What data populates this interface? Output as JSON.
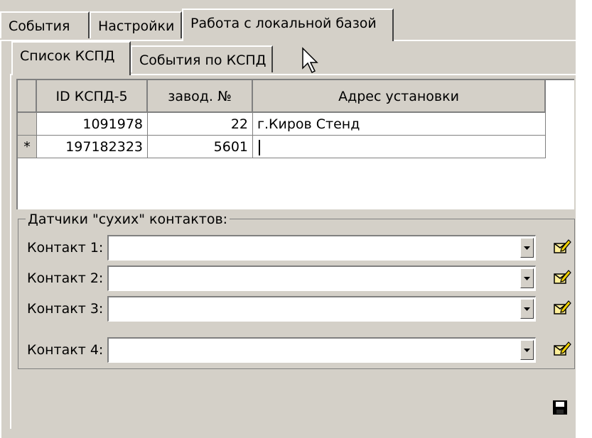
{
  "top_tabs": [
    {
      "label": "События"
    },
    {
      "label": "Настройки"
    },
    {
      "label": "Работа с локальной базой"
    }
  ],
  "inner_tabs": [
    {
      "label": "Список КСПД"
    },
    {
      "label": "События по КСПД"
    }
  ],
  "grid": {
    "columns": [
      "ID КСПД-5",
      "завод. №",
      "Адрес установки"
    ],
    "rows": [
      {
        "indicator": "",
        "id": "1091978",
        "factory_no": "22",
        "address": "г.Киров Стенд"
      },
      {
        "indicator": "*",
        "id": "197182323",
        "factory_no": "5601",
        "address": ""
      }
    ]
  },
  "contacts": {
    "legend": "Датчики \"сухих\" контактов:",
    "items": [
      {
        "label": "Контакт 1:",
        "value": ""
      },
      {
        "label": "Контакт 2:",
        "value": ""
      },
      {
        "label": "Контакт 3:",
        "value": ""
      },
      {
        "label": "Контакт 4:",
        "value": ""
      }
    ]
  },
  "icons": {
    "edit": "edit-icon",
    "save": "save-icon",
    "dropdown": "chevron-down-icon",
    "cursor": "mouse-pointer"
  }
}
